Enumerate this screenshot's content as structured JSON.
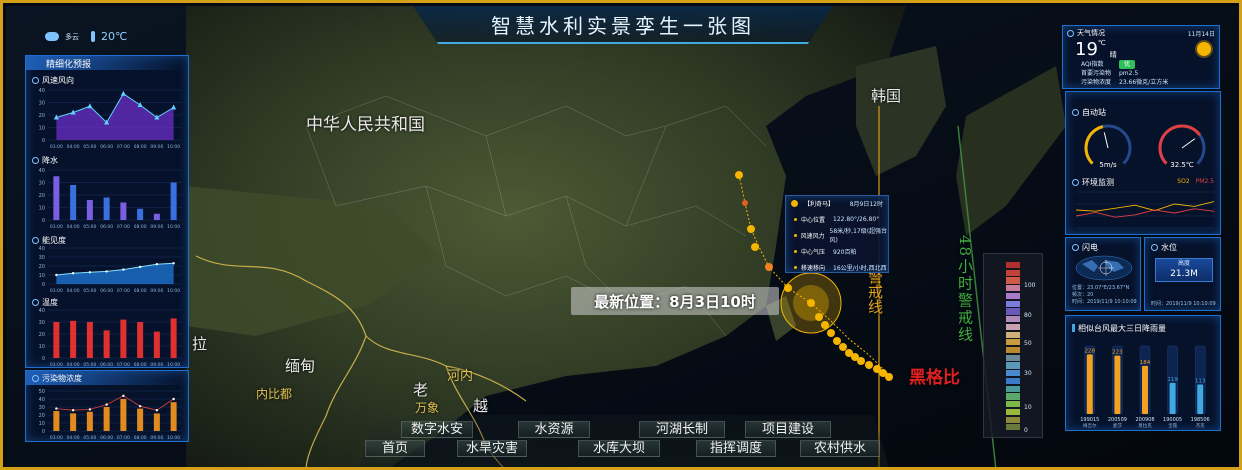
{
  "title": "智慧水利实景孪生一张图",
  "weather_top": {
    "condition": "多云",
    "temp": "20℃"
  },
  "left_panel": {
    "header": "精细化预报",
    "sections": {
      "wind": {
        "label": "风速风向"
      },
      "rain": {
        "label": "降水"
      },
      "visibility": {
        "label": "能见度"
      },
      "temperature": {
        "label": "温度"
      }
    },
    "pollution": {
      "label": "污染物浓度"
    }
  },
  "hours": [
    "03:00",
    "04:00",
    "05:00",
    "06:00",
    "07:00",
    "08:00",
    "09:00",
    "10:00"
  ],
  "chart_data": [
    {
      "type": "area",
      "title": "风速风向",
      "x": [
        "03:00",
        "04:00",
        "05:00",
        "06:00",
        "07:00",
        "08:00",
        "09:00",
        "10:00"
      ],
      "values": [
        18,
        22,
        27,
        14,
        37,
        28,
        18,
        26
      ],
      "ylim": [
        0,
        40
      ],
      "yticks": [
        0,
        10,
        20,
        30,
        40
      ]
    },
    {
      "type": "bar",
      "title": "降水",
      "x": [
        "03:00",
        "04:00",
        "05:00",
        "06:00",
        "07:00",
        "08:00",
        "09:00",
        "10:00"
      ],
      "values": [
        35,
        28,
        16,
        18,
        14,
        9,
        5,
        30
      ],
      "ylim": [
        0,
        40
      ],
      "yticks": [
        0,
        10,
        20,
        30,
        40
      ]
    },
    {
      "type": "area",
      "title": "能见度",
      "x": [
        "03:00",
        "04:00",
        "05:00",
        "06:00",
        "07:00",
        "08:00",
        "09:00",
        "10:00"
      ],
      "values": [
        10,
        12,
        13,
        14,
        16,
        19,
        22,
        23
      ],
      "ylim": [
        0,
        40
      ],
      "yticks": [
        0,
        10,
        20,
        30,
        40
      ]
    },
    {
      "type": "bar",
      "title": "温度",
      "x": [
        "03:00",
        "04:00",
        "05:00",
        "06:00",
        "07:00",
        "08:00",
        "09:00",
        "10:00"
      ],
      "values": [
        30,
        31,
        30,
        23,
        32,
        30,
        22,
        33
      ],
      "ylim": [
        0,
        40
      ],
      "yticks": [
        0,
        10,
        20,
        30,
        40
      ]
    },
    {
      "type": "bar",
      "title": "污染物浓度",
      "x": [
        "03:00",
        "04:00",
        "05:00",
        "06:00",
        "07:00",
        "08:00",
        "09:00",
        "10:00"
      ],
      "values": [
        25,
        22,
        24,
        30,
        40,
        28,
        22,
        36
      ],
      "line": [
        28,
        26,
        27,
        33,
        44,
        31,
        26,
        40
      ],
      "ylim": [
        0,
        50
      ],
      "yticks": [
        0,
        10,
        20,
        30,
        40,
        50
      ]
    },
    {
      "type": "line",
      "title": "环境监测",
      "series": [
        {
          "name": "SO2",
          "values": [
            30,
            28,
            33,
            38,
            29,
            40,
            36,
            44
          ]
        },
        {
          "name": "PM2.5",
          "values": [
            20,
            26,
            18,
            22,
            30,
            25,
            32,
            28
          ]
        }
      ],
      "ylim": [
        0,
        60
      ]
    },
    {
      "type": "bar",
      "title": "相似台风最大三日降雨量",
      "categories": [
        "199015 梅吉尔",
        "200509 麦莎",
        "200908 莫拉克",
        "190005 宝霞",
        "198506 杰克"
      ],
      "series_names": [
        "199015",
        "200509",
        "200908",
        "190005",
        "198506"
      ],
      "sub_names": [
        "梅吉尔",
        "麦莎",
        "莫拉克",
        "宝霞",
        "杰克"
      ],
      "values": [
        228,
        223,
        184,
        119,
        113
      ],
      "ylim": [
        0,
        260
      ]
    }
  ],
  "map": {
    "labels": {
      "china": "中华人民共和国",
      "korea": "韩国",
      "myanmar": "缅甸",
      "laos": "老",
      "laos2": "万象",
      "vietnam": "越",
      "hanoi": "河内",
      "naypyidaw": "内比都",
      "la": "拉"
    },
    "latest_position": "最新位置：8月3日10时",
    "warn_48h": "48小时警戒线",
    "warn_24h": "警戒线",
    "black_grid": "黑格比"
  },
  "typhoon_popup": {
    "name": "【利奇马】",
    "time": "8月9日12时",
    "rows": [
      {
        "label": "中心位置",
        "value": "122.80°/26.80°"
      },
      {
        "label": "风速风力",
        "value": "58米/秒,17级(超强台风)"
      },
      {
        "label": "中心气压",
        "value": "920百帕"
      },
      {
        "label": "移速移向",
        "value": "16公里/小时,西北西"
      }
    ]
  },
  "legend_scale": {
    "ticks": [
      "100",
      "80",
      "50",
      "30",
      "10",
      "0"
    ]
  },
  "right": {
    "weather": {
      "title": "天气情况",
      "date": "11月14日",
      "temp": "19",
      "unit": "℃",
      "condition": "晴",
      "aqi_label": "AQI指数",
      "aqi_value": "优",
      "pollutant_label": "首要污染物",
      "pollutant_value": "pm2.5",
      "density_label": "污染物浓度",
      "density_value": "23.66微克/立方米"
    },
    "auto_station": {
      "title": "自动站",
      "wind_value": "5m/s",
      "temp_value": "32.5℃",
      "wind_level": 0.45,
      "temp_level": 0.7
    },
    "env": {
      "title": "环境监测",
      "legend": [
        "SO2",
        "PM2.5"
      ]
    },
    "lightning": {
      "title": "闪电",
      "pos": "位置：23.07°E/23.67°N",
      "count": "频次：20",
      "time": "时间：2019/11/9 10:10:09"
    },
    "water": {
      "title": "水位",
      "label": "高度",
      "value": "21.3M",
      "time": "时间：2019/11/9 10:10:09"
    },
    "rain_chart": {
      "title": "相似台风最大三日降雨量"
    }
  },
  "nav": {
    "row1": [
      "数字水安",
      "水资源",
      "河湖长制",
      "项目建设"
    ],
    "row2": [
      "首页",
      "水旱灾害",
      "水库大坝",
      "指挥调度",
      "农村供水"
    ]
  },
  "colors": {
    "accent": "#1e6fd0",
    "gold": "#d4a017",
    "typhoon": "#f4b400"
  }
}
